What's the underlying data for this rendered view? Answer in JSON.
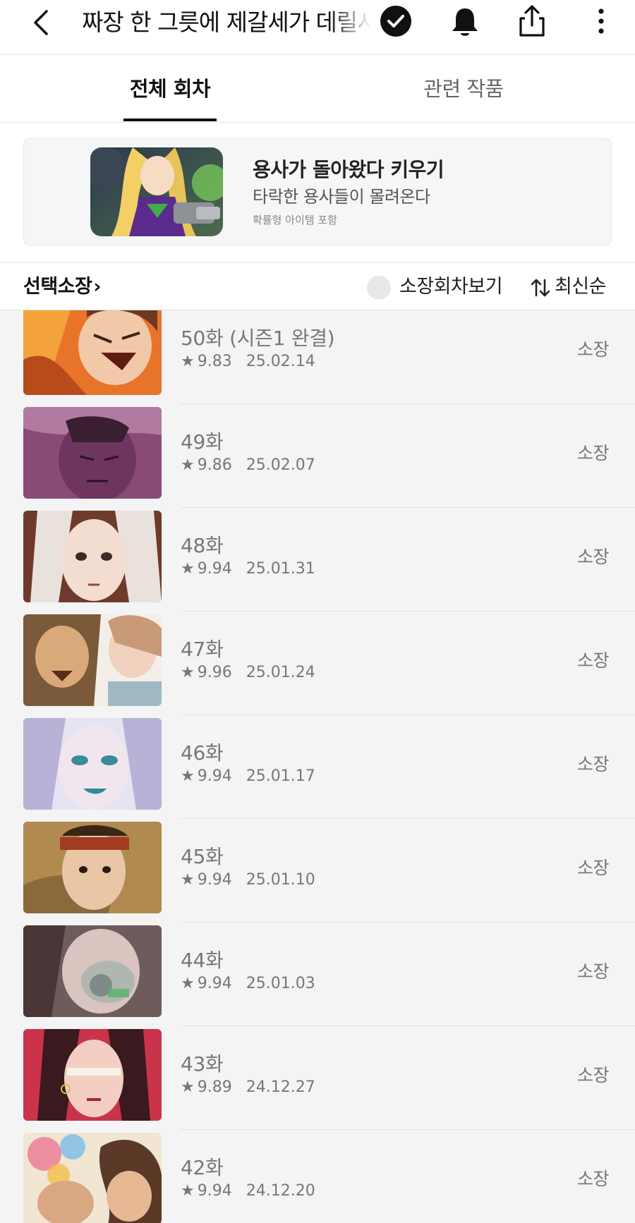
{
  "header": {
    "title": "짜장 한 그릇에 제갈세가 데릴사위",
    "icons": [
      "back-arrow-icon",
      "verified-check-icon",
      "bell-icon",
      "share-icon",
      "more-vertical-icon"
    ]
  },
  "tabs": [
    {
      "label": "전체 회차",
      "active": true
    },
    {
      "label": "관련 작품",
      "active": false
    }
  ],
  "banner": {
    "title": "용사가 돌아왔다 키우기",
    "subtitle": "타락한 용사들이 몰려온다",
    "note": "확률형 아이템 포함"
  },
  "filter": {
    "select_own_label": "선택소장",
    "select_own_chevron": "›",
    "owned_view_label": "소장회차보기",
    "owned_view_on": false,
    "sort_label": "최신순"
  },
  "episodes": [
    {
      "title": "50화 (시즌1 완결)",
      "star": "★",
      "rating": "9.83",
      "date": "25.02.14",
      "action": "소장"
    },
    {
      "title": "49화",
      "star": "★",
      "rating": "9.86",
      "date": "25.02.07",
      "action": "소장"
    },
    {
      "title": "48화",
      "star": "★",
      "rating": "9.94",
      "date": "25.01.31",
      "action": "소장"
    },
    {
      "title": "47화",
      "star": "★",
      "rating": "9.96",
      "date": "25.01.24",
      "action": "소장"
    },
    {
      "title": "46화",
      "star": "★",
      "rating": "9.94",
      "date": "25.01.17",
      "action": "소장"
    },
    {
      "title": "45화",
      "star": "★",
      "rating": "9.94",
      "date": "25.01.10",
      "action": "소장"
    },
    {
      "title": "44화",
      "star": "★",
      "rating": "9.94",
      "date": "25.01.03",
      "action": "소장"
    },
    {
      "title": "43화",
      "star": "★",
      "rating": "9.89",
      "date": "24.12.27",
      "action": "소장"
    },
    {
      "title": "42화",
      "star": "★",
      "rating": "9.94",
      "date": "24.12.20",
      "action": "소장"
    }
  ],
  "colors": {
    "list_background": "#f4f4f4",
    "active_tab": "#111111",
    "muted_text": "#777777"
  }
}
